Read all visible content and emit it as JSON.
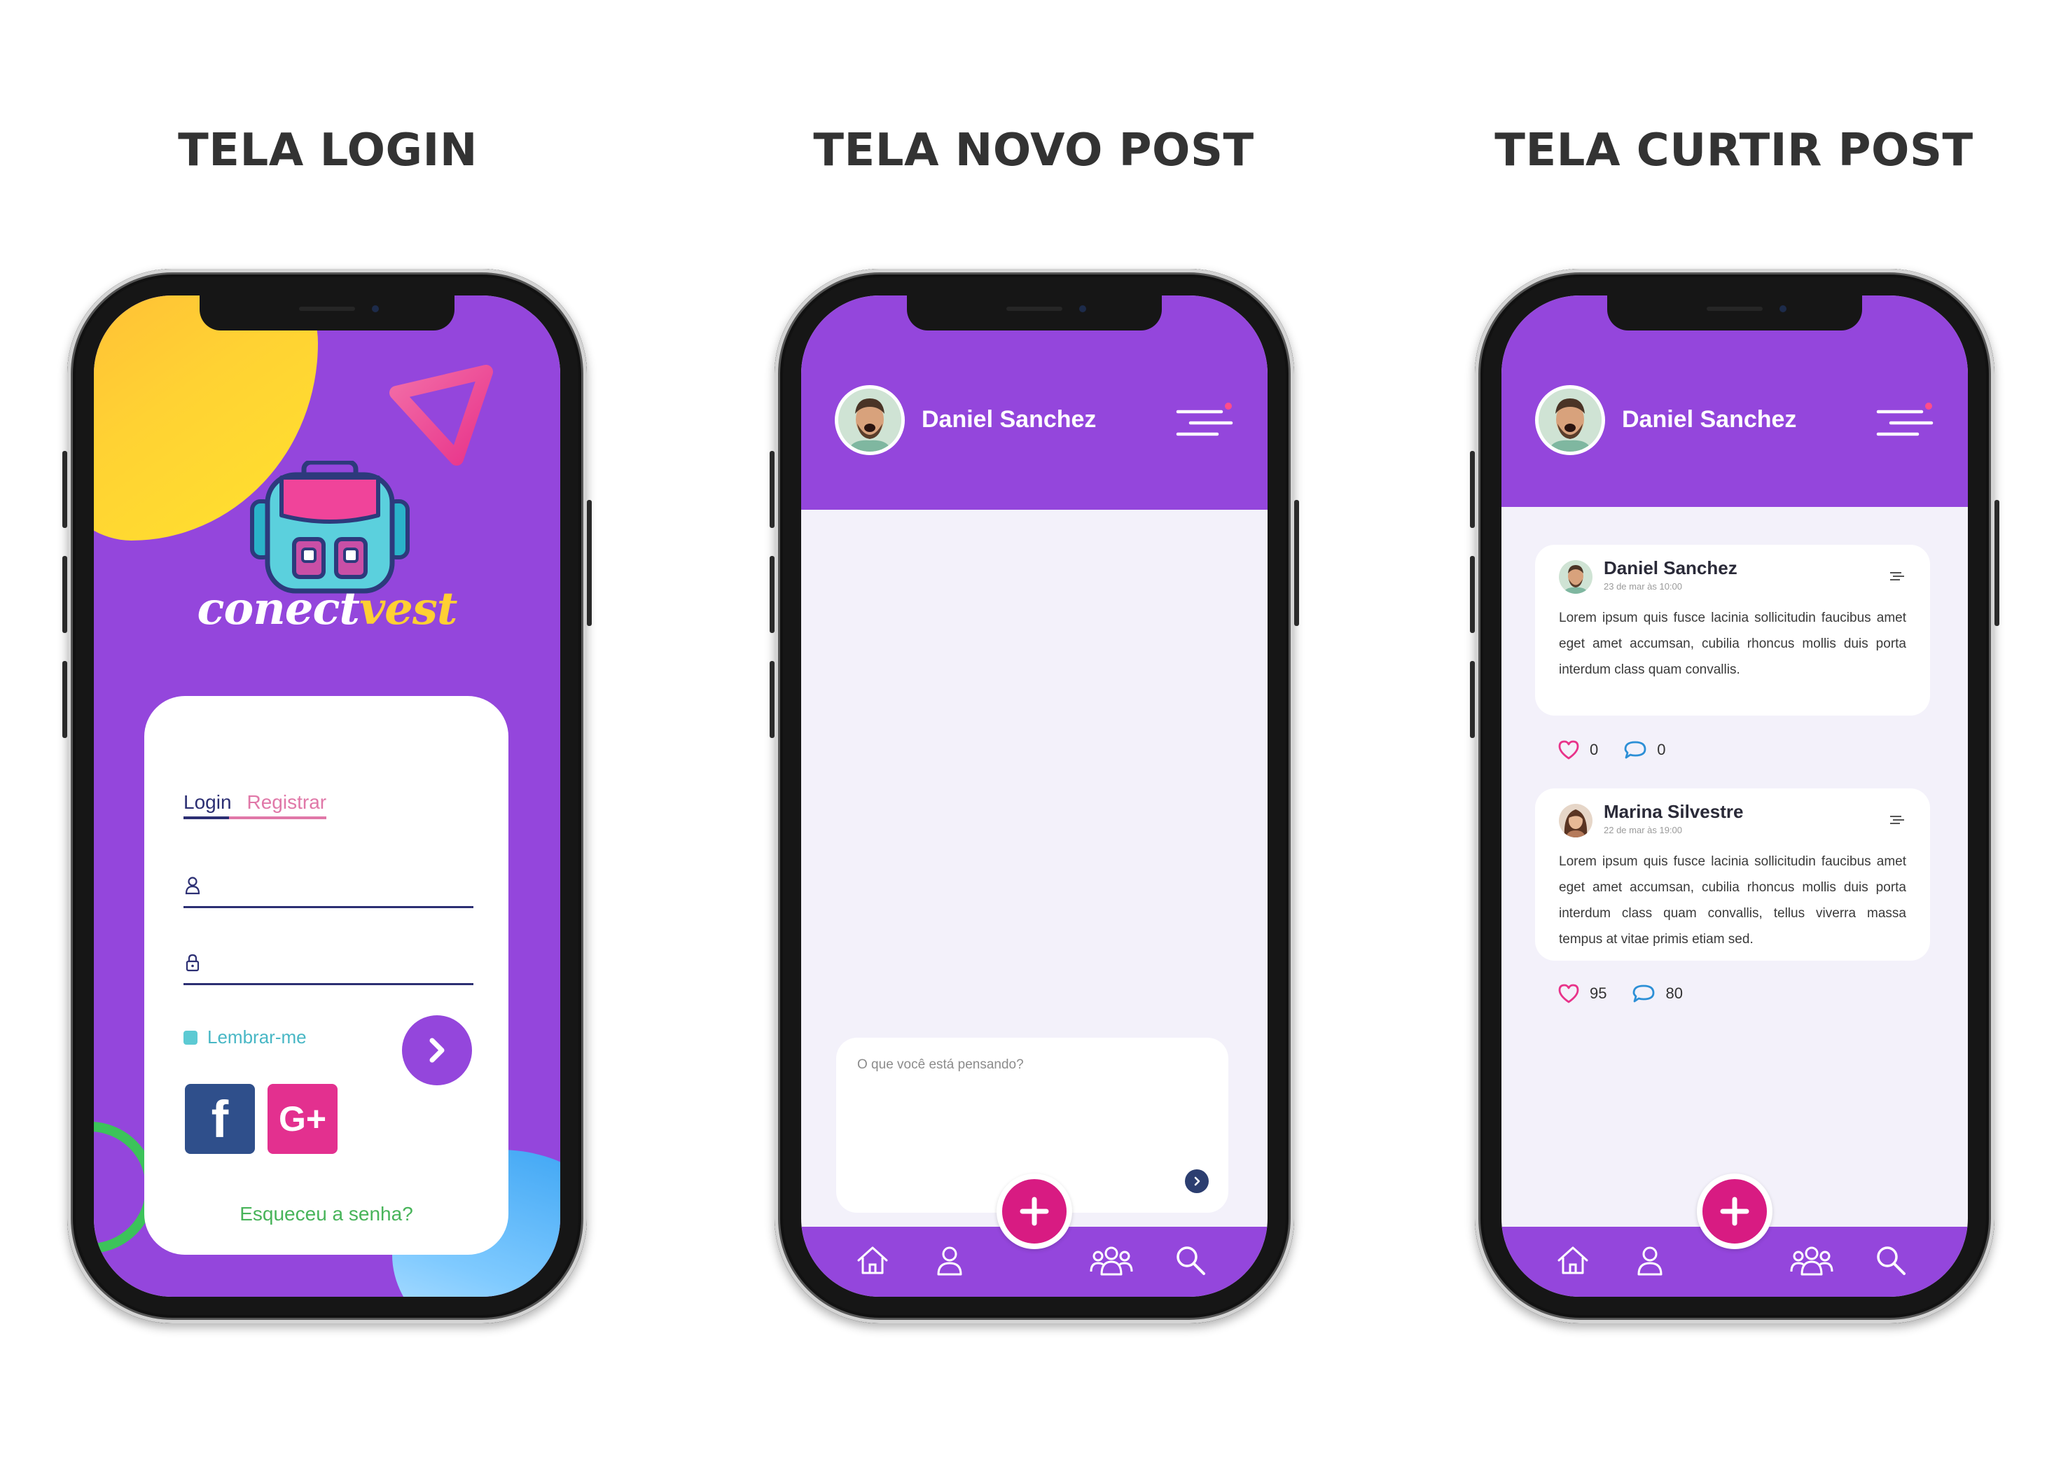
{
  "titles": {
    "login": "TELA LOGIN",
    "new_post": "TELA NOVO POST",
    "like_post": "TELA CURTIR POST"
  },
  "login": {
    "logo": {
      "part1": "conect",
      "part2": "vest"
    },
    "tab_login": "Login",
    "tab_register": "Registrar",
    "remember_label": "Lembrar-me",
    "facebook_label": "f",
    "google_label": "G+",
    "forgot_label": "Esqueceu a senha?"
  },
  "header": {
    "user_name": "Daniel Sanchez"
  },
  "new_post": {
    "compose_placeholder": "O que você está pensando?"
  },
  "feed": {
    "posts": [
      {
        "author": "Daniel Sanchez",
        "time": "23 de mar às 10:00",
        "text": "Lorem ipsum quis fusce lacinia sollicitudin faucibus amet eget amet accumsan, cubilia rhoncus mollis duis porta interdum class quam convallis.",
        "likes": "0",
        "comments": "0"
      },
      {
        "author": "Marina Silvestre",
        "time": "22 de mar às 19:00",
        "text": "Lorem ipsum quis fusce lacinia sollicitudin faucibus amet eget amet accumsan, cubilia rhoncus mollis duis porta interdum class quam convallis, tellus viverra massa tempus at vitae primis etiam sed.",
        "likes": "95",
        "comments": "80"
      }
    ]
  },
  "colors": {
    "brand_purple": "#9446dc",
    "accent_pink": "#d81b82",
    "accent_yellow": "#ffcf33",
    "link_teal": "#48b7c5",
    "forgot_green": "#48b45a",
    "facebook_blue": "#2f4f8b"
  },
  "icons": {
    "nav": [
      "home-icon",
      "profile-icon",
      "groups-icon",
      "search-icon"
    ],
    "fab": "plus-icon",
    "header_menu": "menu-icon",
    "like": "heart-icon",
    "comment": "comment-icon"
  }
}
